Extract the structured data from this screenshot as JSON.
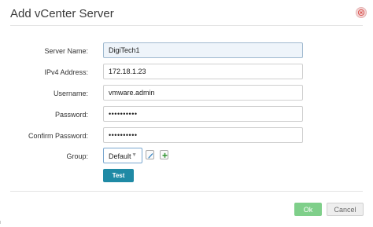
{
  "dialog": {
    "title": "Add vCenter Server"
  },
  "form": {
    "server_name": {
      "label": "Server Name:",
      "value": "DigiTech1"
    },
    "ipv4": {
      "label": "IPv4 Address:",
      "value": "172.18.1.23"
    },
    "username": {
      "label": "Username:",
      "value": "vmware.admin"
    },
    "password": {
      "label": "Password:",
      "value": "••••••••••"
    },
    "confirm_password": {
      "label": "Confirm Password:",
      "value": "••••••••••"
    },
    "group": {
      "label": "Group:",
      "selected": "Default"
    }
  },
  "buttons": {
    "test": "Test",
    "ok": "Ok",
    "cancel": "Cancel"
  },
  "colors": {
    "test_button": "#1f8aa5",
    "ok_button": "#7fcf8a",
    "close_icon": "#d9534f",
    "add_icon": "#3c9a3c"
  },
  "icons": {
    "close": "close-circle-icon",
    "edit": "edit-icon",
    "add": "plus-icon",
    "dropdown": "chevron-down-icon"
  }
}
